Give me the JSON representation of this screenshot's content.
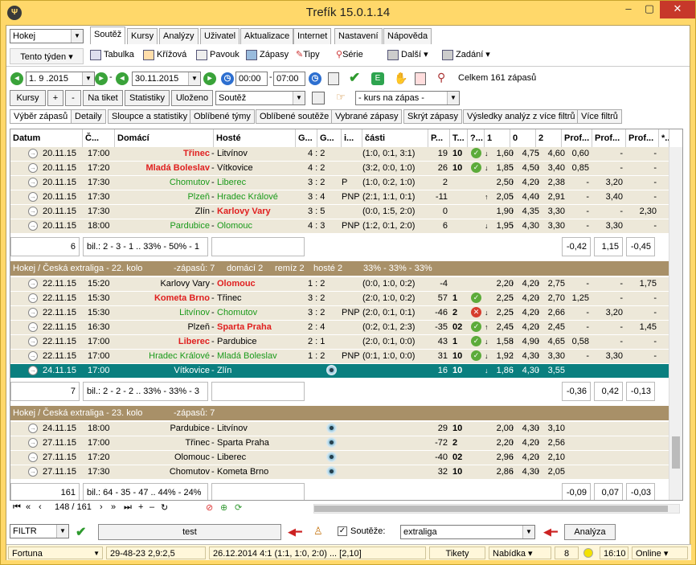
{
  "window": {
    "title": "Trefík 15.0.1.14",
    "min": "–",
    "max": "▢",
    "close": "✕"
  },
  "sport": "Hokej",
  "period": "Tento týden",
  "menu_tabs": [
    "Soutěž",
    "Kursy",
    "Analýzy",
    "Uživatel",
    "Aktualizace",
    "Internet",
    "Nastavení",
    "Nápověda"
  ],
  "toolbar": {
    "tabulka": "Tabulka",
    "krizova": "Křížová",
    "pavouk": "Pavouk",
    "zapasy": "Zápasy",
    "tipy": "Tipy",
    "serie": "Série",
    "dalsi": "Další",
    "zadani": "Zadání"
  },
  "filter": {
    "date_from": "1. 9 .2015",
    "date_to": "30.11.2015",
    "time_from": "00:00",
    "time_to": "07:00",
    "total": "Celkem 161 zápasů"
  },
  "buttons": {
    "kursy": "Kursy",
    "plus": "+",
    "minus": "-",
    "na_tiket": "Na tiket",
    "statistiky": "Statistiky",
    "ulozeno": "Uloženo",
    "soutez": "Soutěž",
    "kurs": "- kurs na zápas -"
  },
  "subtabs": [
    "Výběr zápasů",
    "Detaily",
    "Sloupce a statistiky",
    "Oblíbené týmy",
    "Oblíbené soutěže",
    "Vybrané zápasy",
    "Skrýt zápasy",
    "Výsledky analýz z více filtrů",
    "Více filtrů"
  ],
  "columns": [
    "Datum",
    "Č...",
    "Domácí",
    "Hosté",
    "G...",
    "G...",
    "i...",
    "části",
    "P...",
    "T...",
    "?...",
    "1",
    "0",
    "2",
    "Prof...",
    "Prof...",
    "Prof...",
    "*..."
  ],
  "group1": {
    "rows": [
      {
        "date": "20.11.15",
        "time": "17:00",
        "home": "Třinec",
        "away": "Litvínov",
        "score": "4 : 2",
        "note": "",
        "parts": "(1:0, 0:1, 3:1)",
        "p": "19",
        "t": "10",
        "ok": "tick",
        "k1": "1,60",
        "k0": "4,75",
        "k2": "4,60",
        "a1": "↓",
        "a0": "↑",
        "a2": "↑",
        "pr1": "0,60",
        "pr2": "-",
        "pr3": "-",
        "hs": "red",
        "as": ""
      },
      {
        "date": "20.11.15",
        "time": "17:20",
        "home": "Mladá Boleslav",
        "away": "Vítkovice",
        "score": "4 : 2",
        "note": "",
        "parts": "(3:2, 0:0, 1:0)",
        "p": "26",
        "t": "10",
        "ok": "tick",
        "k1": "1,85",
        "k0": "4,50",
        "k2": "3,40",
        "a1": "↓",
        "a0": "↑",
        "a2": "↑",
        "pr1": "0,85",
        "pr2": "-",
        "pr3": "-",
        "hs": "red",
        "as": ""
      },
      {
        "date": "20.11.15",
        "time": "17:30",
        "home": "Chomutov",
        "away": "Liberec",
        "score": "3 : 2",
        "note": "P",
        "parts": "(1:0, 0:2, 1:0)",
        "p": "2",
        "t": "",
        "ok": "",
        "k1": "2,50",
        "k0": "4,20",
        "k2": "2,38",
        "a1": "",
        "a0": "↑",
        "a2": "↑",
        "pr1": "-",
        "pr2": "3,20",
        "pr3": "-",
        "hs": "green",
        "as": "green"
      },
      {
        "date": "20.11.15",
        "time": "17:30",
        "home": "Plzeň",
        "away": "Hradec Králové",
        "score": "3 : 4",
        "note": "PNP",
        "parts": "(2:1, 1:1, 0:1)",
        "p": "-11",
        "t": "",
        "ok": "",
        "k1": "2,05",
        "k0": "4,40",
        "k2": "2,91",
        "a1": "↑",
        "a0": "↑",
        "a2": "↑",
        "pr1": "-",
        "pr2": "3,40",
        "pr3": "-",
        "hs": "green",
        "as": "green"
      },
      {
        "date": "20.11.15",
        "time": "17:30",
        "home": "Zlín",
        "away": "Karlovy Vary",
        "score": "3 : 5",
        "note": "",
        "parts": "(0:0, 1:5, 2:0)",
        "p": "0",
        "t": "",
        "ok": "",
        "k1": "1,90",
        "k0": "4,35",
        "k2": "3,30",
        "a1": "",
        "a0": "↑",
        "a2": "",
        "pr1": "-",
        "pr2": "-",
        "pr3": "2,30",
        "hs": "",
        "as": "red"
      },
      {
        "date": "20.11.15",
        "time": "18:00",
        "home": "Pardubice",
        "away": "Olomouc",
        "score": "4 : 3",
        "note": "PNP",
        "parts": "(1:2, 0:1, 2:0)",
        "p": "6",
        "t": "",
        "ok": "",
        "k1": "1,95",
        "k0": "4,30",
        "k2": "3,30",
        "a1": "↓",
        "a0": "↑",
        "a2": "",
        "pr1": "-",
        "pr2": "3,30",
        "pr3": "-",
        "hs": "green",
        "as": "green"
      }
    ],
    "sum": {
      "count": "6",
      "bil": "bil.: 2 - 3 - 1 .. 33% - 50% - 1",
      "p1": "-0,42",
      "p2": "1,15",
      "p3": "-0,45"
    }
  },
  "group2": {
    "header": {
      "title": "Hokej / Česká extraliga - 22. kolo",
      "count": "-zápasů: 7",
      "home": "domácí 2",
      "draw": "remíz 2",
      "away": "hosté 2",
      "pct": "33% - 33% - 33%"
    },
    "rows": [
      {
        "date": "22.11.15",
        "time": "15:20",
        "home": "Karlovy Vary",
        "away": "Olomouc",
        "score": "1 : 2",
        "note": "",
        "parts": "(0:0, 1:0, 0:2)",
        "p": "-4",
        "t": "",
        "ok": "",
        "k1": "2,20",
        "k0": "4,20",
        "k2": "2,75",
        "a1": "",
        "a0": "↑",
        "a2": "↑",
        "pr1": "-",
        "pr2": "-",
        "pr3": "1,75",
        "hs": "",
        "as": "red"
      },
      {
        "date": "22.11.15",
        "time": "15:30",
        "home": "Kometa Brno",
        "away": "Třinec",
        "score": "3 : 2",
        "note": "",
        "parts": "(2:0, 1:0, 0:2)",
        "p": "57",
        "t": "1",
        "ok": "tick",
        "k1": "2,25",
        "k0": "4,20",
        "k2": "2,70",
        "a1": "",
        "a0": "↑",
        "a2": "↑",
        "pr1": "1,25",
        "pr2": "-",
        "pr3": "-",
        "hs": "red",
        "as": ""
      },
      {
        "date": "22.11.15",
        "time": "15:30",
        "home": "Litvínov",
        "away": "Chomutov",
        "score": "3 : 2",
        "note": "PNP",
        "parts": "(2:0, 0:1, 0:1)",
        "p": "-46",
        "t": "2",
        "ok": "cross",
        "k1": "2,25",
        "k0": "4,20",
        "k2": "2,66",
        "a1": "↓",
        "a0": "↑",
        "a2": "↑",
        "pr1": "-",
        "pr2": "3,20",
        "pr3": "-",
        "hs": "green",
        "as": "green"
      },
      {
        "date": "22.11.15",
        "time": "16:30",
        "home": "Plzeň",
        "away": "Sparta Praha",
        "score": "2 : 4",
        "note": "",
        "parts": "(0:2, 0:1, 2:3)",
        "p": "-35",
        "t": "02",
        "ok": "tick",
        "k1": "2,45",
        "k0": "4,20",
        "k2": "2,45",
        "a1": "↑",
        "a0": "↑",
        "a2": "↑",
        "pr1": "-",
        "pr2": "-",
        "pr3": "1,45",
        "hs": "",
        "as": "red"
      },
      {
        "date": "22.11.15",
        "time": "17:00",
        "home": "Liberec",
        "away": "Pardubice",
        "score": "2 : 1",
        "note": "",
        "parts": "(2:0, 0:1, 0:0)",
        "p": "43",
        "t": "1",
        "ok": "tick",
        "k1": "1,58",
        "k0": "4,90",
        "k2": "4,65",
        "a1": "↓",
        "a0": "↑",
        "a2": "↑",
        "pr1": "0,58",
        "pr2": "-",
        "pr3": "-",
        "hs": "red",
        "as": ""
      },
      {
        "date": "22.11.15",
        "time": "17:00",
        "home": "Hradec Králové",
        "away": "Mladá Boleslav",
        "score": "1 : 2",
        "note": "PNP",
        "parts": "(0:1, 1:0, 0:0)",
        "p": "31",
        "t": "10",
        "ok": "tick",
        "k1": "1,92",
        "k0": "4,30",
        "k2": "3,30",
        "a1": "↓",
        "a0": "↑",
        "a2": "↑",
        "pr1": "-",
        "pr2": "3,30",
        "pr3": "-",
        "hs": "green",
        "as": "green"
      }
    ],
    "selected": {
      "date": "24.11.15",
      "time": "17:00",
      "home": "Vítkovice",
      "away": "Zlín",
      "p": "16",
      "t": "10",
      "k1": "1,86",
      "k0": "4,30",
      "k2": "3,55",
      "a1": "↓",
      "a0": "↑",
      "a2": "↑"
    },
    "sum": {
      "count": "7",
      "bil": "bil.: 2 - 2 - 2 .. 33% - 33% - 3",
      "p1": "-0,36",
      "p2": "0,42",
      "p3": "-0,13"
    }
  },
  "group3": {
    "header": {
      "title": "Hokej / Česká extraliga - 23. kolo",
      "count": "-zápasů: 7"
    },
    "rows": [
      {
        "date": "24.11.15",
        "time": "18:00",
        "home": "Pardubice",
        "away": "Litvínov",
        "p": "29",
        "t": "10",
        "k1": "2,00",
        "k0": "4,30",
        "k2": "3,10",
        "a1": "",
        "a0": "↑",
        "a2": "↑"
      },
      {
        "date": "27.11.15",
        "time": "17:00",
        "home": "Třinec",
        "away": "Sparta Praha",
        "p": "-72",
        "t": "2",
        "k1": "2,20",
        "k0": "4,20",
        "k2": "2,56",
        "a1": "",
        "a0": "↑",
        "a2": "↑"
      },
      {
        "date": "27.11.15",
        "time": "17:20",
        "home": "Olomouc",
        "away": "Liberec",
        "p": "-40",
        "t": "02",
        "k1": "2,96",
        "k0": "4,20",
        "k2": "2,10",
        "a1": "",
        "a0": "↑",
        "a2": "↑"
      },
      {
        "date": "27.11.15",
        "time": "17:30",
        "home": "Chomutov",
        "away": "Kometa Brno",
        "p": "32",
        "t": "10",
        "k1": "2,86",
        "k0": "4,30",
        "k2": "2,05",
        "a1": "",
        "a0": "↑",
        "a2": "↑"
      }
    ],
    "sum": {
      "count": "161",
      "bil": "bil.: 64 - 35 - 47 .. 44% - 24%",
      "p1": "-0,09",
      "p2": "0,07",
      "p3": "-0,03"
    }
  },
  "nav": {
    "position": "148 / 161"
  },
  "bottom": {
    "filtr": "FILTR",
    "test": "test",
    "soutez_label": "Soutěže:",
    "soutez_value": "extraliga",
    "analyza": "Analýza"
  },
  "status": {
    "bookmaker": "Fortuna",
    "stats": "29-48-23  2,9:2,5",
    "last": "26.12.2014 4:1 (1:1, 1:0, 2:0) ... [2,10]",
    "tikety": "Tikety",
    "nabidka": "Nabídka",
    "count": "8",
    "time": "16:10",
    "online": "Online"
  }
}
